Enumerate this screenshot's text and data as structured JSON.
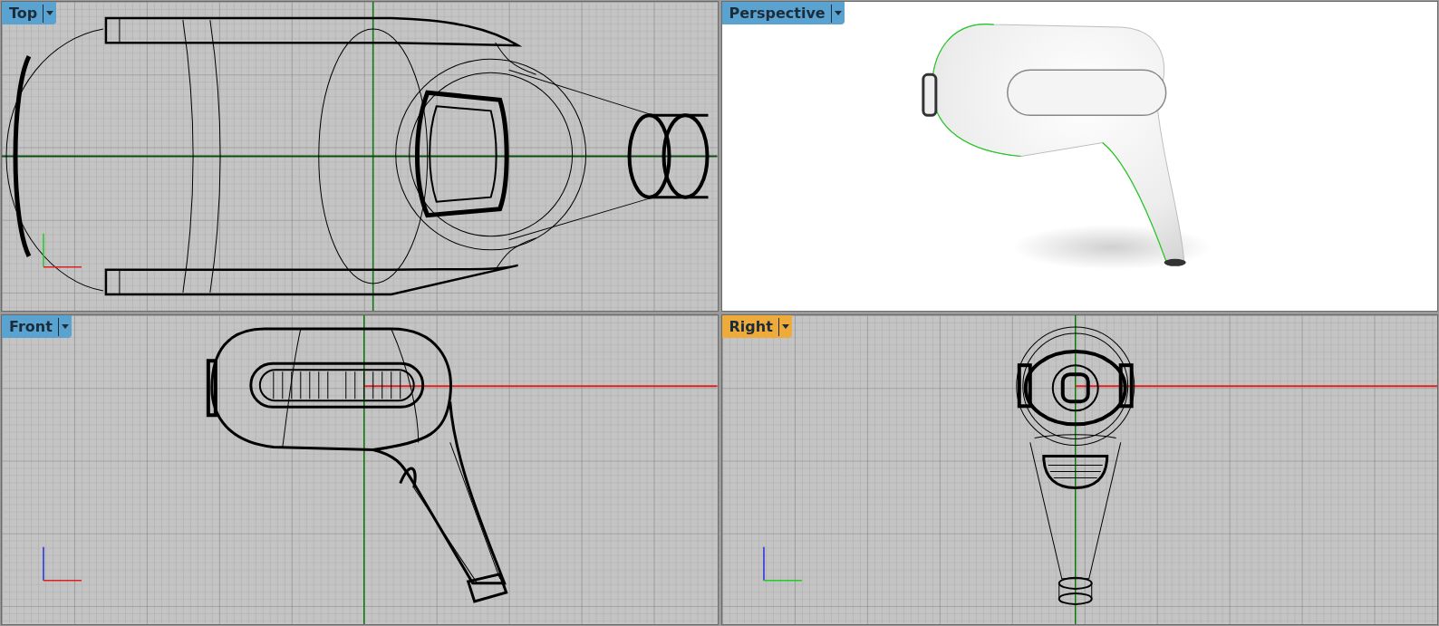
{
  "viewports": [
    {
      "label": "Top",
      "selected": false,
      "kind": "top"
    },
    {
      "label": "Perspective",
      "selected": false,
      "kind": "perspective"
    },
    {
      "label": "Front",
      "selected": false,
      "kind": "front"
    },
    {
      "label": "Right",
      "selected": true,
      "kind": "right"
    }
  ]
}
